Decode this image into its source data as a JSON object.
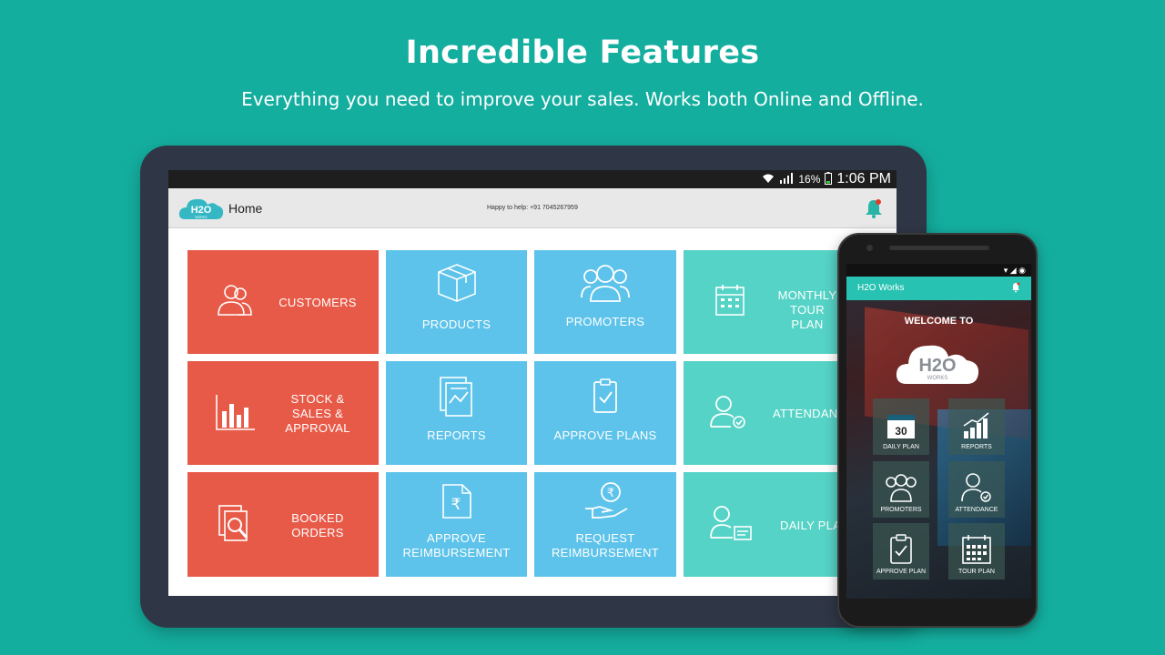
{
  "hero": {
    "title": "Incredible Features",
    "subtitle": "Everything you need to improve your sales. Works both Online and Offline."
  },
  "tablet": {
    "status": {
      "battery": "16%",
      "time": "1:06 PM"
    },
    "appbar": {
      "logo_text": "H2O",
      "logo_sub": "WORKS",
      "title": "Home",
      "help": "Happy to help: +91 7045267959"
    },
    "tiles": {
      "customers": "CUSTOMERS",
      "stock": "STOCK &\nSALES &\nAPPROVAL",
      "booked": "BOOKED\nORDERS",
      "products": "PRODUCTS",
      "reports": "REPORTS",
      "approve_reimb": "APPROVE\nREIMBURSEMENT",
      "promoters": "PROMOTERS",
      "approve_plans": "APPROVE PLANS",
      "request_reimb": "REQUEST\nREIMBURSEMENT",
      "monthly": "MONTHLY TOUR\nPLAN",
      "attendance": "ATTENDANCE",
      "daily": "DAILY PLAN"
    }
  },
  "phone": {
    "appbar_title": "H2O Works",
    "welcome": "WELCOME TO",
    "logo_text": "H2O",
    "logo_sub": "WORKS",
    "calendar_day": "30",
    "tiles": {
      "daily_plan": "DAILY PLAN",
      "reports": "REPORTS",
      "promoters": "PROMOTERS",
      "attendance": "ATTENDANCE",
      "approve_plan": "APPROVE PLAN",
      "tour_plan": "TOUR PLAN"
    }
  },
  "colors": {
    "background": "#14ae9f",
    "red": "#e85a48",
    "blue": "#5ec3ea",
    "teal": "#55d3c6",
    "appbar_teal": "#27c2b1"
  }
}
